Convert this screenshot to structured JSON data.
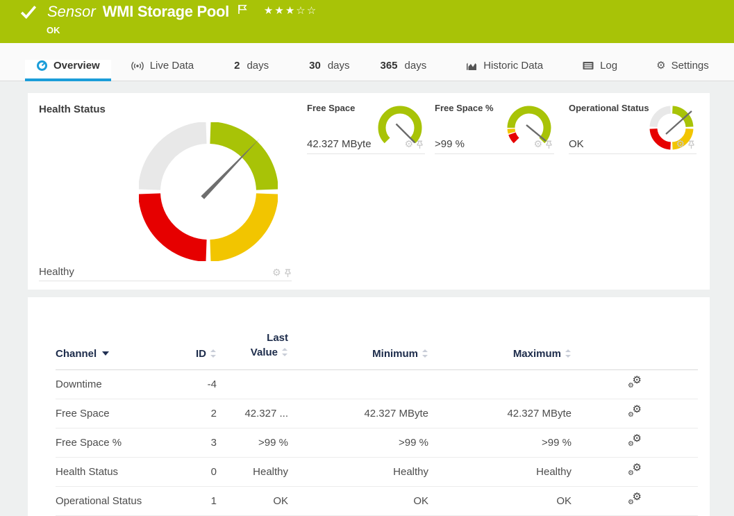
{
  "header": {
    "type_label": "Sensor",
    "title": "WMI Storage Pool",
    "status": "OK",
    "stars": "★★★☆☆",
    "stars_filled": 3,
    "stars_total": 5
  },
  "tabs": [
    {
      "label": "Overview",
      "icon": "gauge-icon",
      "active": true
    },
    {
      "label": "Live Data",
      "icon": "broadcast-icon",
      "active": false
    },
    {
      "num": "2",
      "label": "days",
      "active": false
    },
    {
      "num": "30",
      "label": "days",
      "active": false
    },
    {
      "num": "365",
      "label": "days",
      "active": false
    },
    {
      "label": "Historic Data",
      "icon": "area-chart-icon",
      "active": false
    },
    {
      "label": "Log",
      "icon": "log-icon",
      "active": false
    },
    {
      "label": "Settings",
      "icon": "gear-icon",
      "active": false
    }
  ],
  "overview": {
    "health": {
      "title": "Health Status",
      "value": "Healthy",
      "gauge_type": "quadrant-status",
      "segments": [
        "green-ok",
        "yellow-warning",
        "red-error",
        "gray-unknown"
      ],
      "needle_direction": "upper-right"
    },
    "minis": [
      {
        "title": "Free Space",
        "value": "42.327 MByte",
        "gauge_type": "radial",
        "segments": [
          "green"
        ],
        "needle_direction": "lower-right-max"
      },
      {
        "title": "Free Space %",
        "value": ">99 %",
        "gauge_type": "radial",
        "segments": [
          "red",
          "yellow",
          "green"
        ],
        "needle_direction": "lower-right-max"
      },
      {
        "title": "Operational Status",
        "value": "OK",
        "gauge_type": "quadrant-status",
        "segments": [
          "green-ok",
          "yellow-warning",
          "red-error",
          "gray-unknown"
        ],
        "needle_direction": "upper-right"
      }
    ]
  },
  "table": {
    "sorted_by": "Channel",
    "headers": {
      "channel": "Channel",
      "id": "ID",
      "last": "Last Value",
      "min": "Minimum",
      "max": "Maximum"
    },
    "rows": [
      {
        "channel": "Downtime",
        "id": "-4",
        "last": "",
        "min": "",
        "max": ""
      },
      {
        "channel": "Free Space",
        "id": "2",
        "last": "42.327 ...",
        "min": "42.327 MByte",
        "max": "42.327 MByte"
      },
      {
        "channel": "Free Space %",
        "id": "3",
        "last": ">99 %",
        "min": ">99 %",
        "max": ">99 %"
      },
      {
        "channel": "Health Status",
        "id": "0",
        "last": "Healthy",
        "min": "Healthy",
        "max": "Healthy"
      },
      {
        "channel": "Operational Status",
        "id": "1",
        "last": "OK",
        "min": "OK",
        "max": "OK"
      }
    ]
  },
  "colors": {
    "brand_green": "#a8c307",
    "status_yellow": "#f2c500",
    "status_red": "#e60000",
    "neutral_gray": "#e8e8e8",
    "accent_blue": "#1b9dd9",
    "needle_gray": "#6e6e6e"
  }
}
